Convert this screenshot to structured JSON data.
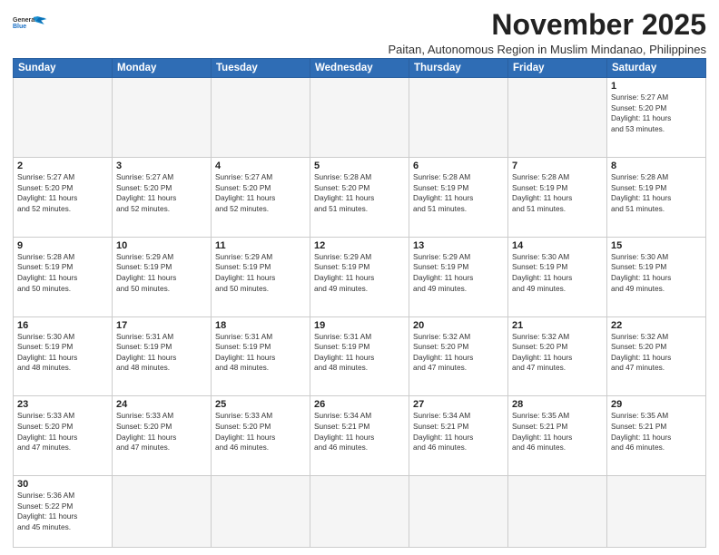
{
  "logo": {
    "line1": "General",
    "line2": "Blue"
  },
  "title": "November 2025",
  "subtitle": "Paitan, Autonomous Region in Muslim Mindanao, Philippines",
  "days_of_week": [
    "Sunday",
    "Monday",
    "Tuesday",
    "Wednesday",
    "Thursday",
    "Friday",
    "Saturday"
  ],
  "weeks": [
    [
      {
        "day": "",
        "info": ""
      },
      {
        "day": "",
        "info": ""
      },
      {
        "day": "",
        "info": ""
      },
      {
        "day": "",
        "info": ""
      },
      {
        "day": "",
        "info": ""
      },
      {
        "day": "",
        "info": ""
      },
      {
        "day": "1",
        "info": "Sunrise: 5:27 AM\nSunset: 5:20 PM\nDaylight: 11 hours\nand 53 minutes."
      }
    ],
    [
      {
        "day": "2",
        "info": "Sunrise: 5:27 AM\nSunset: 5:20 PM\nDaylight: 11 hours\nand 52 minutes."
      },
      {
        "day": "3",
        "info": "Sunrise: 5:27 AM\nSunset: 5:20 PM\nDaylight: 11 hours\nand 52 minutes."
      },
      {
        "day": "4",
        "info": "Sunrise: 5:27 AM\nSunset: 5:20 PM\nDaylight: 11 hours\nand 52 minutes."
      },
      {
        "day": "5",
        "info": "Sunrise: 5:28 AM\nSunset: 5:20 PM\nDaylight: 11 hours\nand 51 minutes."
      },
      {
        "day": "6",
        "info": "Sunrise: 5:28 AM\nSunset: 5:19 PM\nDaylight: 11 hours\nand 51 minutes."
      },
      {
        "day": "7",
        "info": "Sunrise: 5:28 AM\nSunset: 5:19 PM\nDaylight: 11 hours\nand 51 minutes."
      },
      {
        "day": "8",
        "info": "Sunrise: 5:28 AM\nSunset: 5:19 PM\nDaylight: 11 hours\nand 51 minutes."
      }
    ],
    [
      {
        "day": "9",
        "info": "Sunrise: 5:28 AM\nSunset: 5:19 PM\nDaylight: 11 hours\nand 50 minutes."
      },
      {
        "day": "10",
        "info": "Sunrise: 5:29 AM\nSunset: 5:19 PM\nDaylight: 11 hours\nand 50 minutes."
      },
      {
        "day": "11",
        "info": "Sunrise: 5:29 AM\nSunset: 5:19 PM\nDaylight: 11 hours\nand 50 minutes."
      },
      {
        "day": "12",
        "info": "Sunrise: 5:29 AM\nSunset: 5:19 PM\nDaylight: 11 hours\nand 49 minutes."
      },
      {
        "day": "13",
        "info": "Sunrise: 5:29 AM\nSunset: 5:19 PM\nDaylight: 11 hours\nand 49 minutes."
      },
      {
        "day": "14",
        "info": "Sunrise: 5:30 AM\nSunset: 5:19 PM\nDaylight: 11 hours\nand 49 minutes."
      },
      {
        "day": "15",
        "info": "Sunrise: 5:30 AM\nSunset: 5:19 PM\nDaylight: 11 hours\nand 49 minutes."
      }
    ],
    [
      {
        "day": "16",
        "info": "Sunrise: 5:30 AM\nSunset: 5:19 PM\nDaylight: 11 hours\nand 48 minutes."
      },
      {
        "day": "17",
        "info": "Sunrise: 5:31 AM\nSunset: 5:19 PM\nDaylight: 11 hours\nand 48 minutes."
      },
      {
        "day": "18",
        "info": "Sunrise: 5:31 AM\nSunset: 5:19 PM\nDaylight: 11 hours\nand 48 minutes."
      },
      {
        "day": "19",
        "info": "Sunrise: 5:31 AM\nSunset: 5:19 PM\nDaylight: 11 hours\nand 48 minutes."
      },
      {
        "day": "20",
        "info": "Sunrise: 5:32 AM\nSunset: 5:20 PM\nDaylight: 11 hours\nand 47 minutes."
      },
      {
        "day": "21",
        "info": "Sunrise: 5:32 AM\nSunset: 5:20 PM\nDaylight: 11 hours\nand 47 minutes."
      },
      {
        "day": "22",
        "info": "Sunrise: 5:32 AM\nSunset: 5:20 PM\nDaylight: 11 hours\nand 47 minutes."
      }
    ],
    [
      {
        "day": "23",
        "info": "Sunrise: 5:33 AM\nSunset: 5:20 PM\nDaylight: 11 hours\nand 47 minutes."
      },
      {
        "day": "24",
        "info": "Sunrise: 5:33 AM\nSunset: 5:20 PM\nDaylight: 11 hours\nand 47 minutes."
      },
      {
        "day": "25",
        "info": "Sunrise: 5:33 AM\nSunset: 5:20 PM\nDaylight: 11 hours\nand 46 minutes."
      },
      {
        "day": "26",
        "info": "Sunrise: 5:34 AM\nSunset: 5:21 PM\nDaylight: 11 hours\nand 46 minutes."
      },
      {
        "day": "27",
        "info": "Sunrise: 5:34 AM\nSunset: 5:21 PM\nDaylight: 11 hours\nand 46 minutes."
      },
      {
        "day": "28",
        "info": "Sunrise: 5:35 AM\nSunset: 5:21 PM\nDaylight: 11 hours\nand 46 minutes."
      },
      {
        "day": "29",
        "info": "Sunrise: 5:35 AM\nSunset: 5:21 PM\nDaylight: 11 hours\nand 46 minutes."
      }
    ],
    [
      {
        "day": "30",
        "info": "Sunrise: 5:36 AM\nSunset: 5:22 PM\nDaylight: 11 hours\nand 45 minutes."
      },
      {
        "day": "",
        "info": ""
      },
      {
        "day": "",
        "info": ""
      },
      {
        "day": "",
        "info": ""
      },
      {
        "day": "",
        "info": ""
      },
      {
        "day": "",
        "info": ""
      },
      {
        "day": "",
        "info": ""
      }
    ]
  ]
}
